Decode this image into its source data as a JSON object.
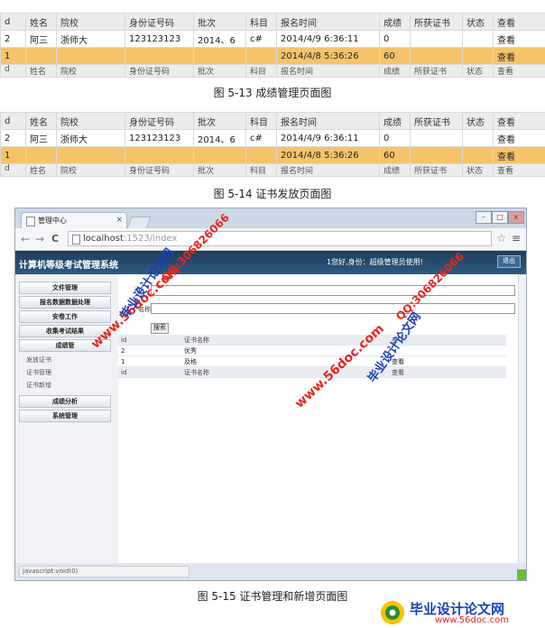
{
  "table_5_13": {
    "header": [
      "d",
      "姓名",
      "院校",
      "身份证号码",
      "批次",
      "科目",
      "报名时间",
      "成绩",
      "所获证书",
      "状态",
      "查看"
    ],
    "rows": [
      [
        "2",
        "阿三",
        "浙师大",
        "123123123",
        "2014、6",
        "c#",
        "2014/4/9 6:36:11",
        "0",
        "",
        "",
        "查看"
      ],
      [
        "1",
        "",
        "",
        "",
        "",
        "",
        "2014/4/8 5:36:26",
        "60",
        "",
        "",
        "查看"
      ]
    ],
    "footer": [
      "d",
      "姓名",
      "院校",
      "身份证号码",
      "批次",
      "科目",
      "报名时间",
      "成绩",
      "所获证书",
      "状态",
      "查看"
    ]
  },
  "caption_5_13": "图 5-13 成绩管理页面图",
  "table_5_14": {
    "header": [
      "d",
      "姓名",
      "院校",
      "身份证号码",
      "批次",
      "科目",
      "报名时间",
      "成绩",
      "所获证书",
      "状态",
      "查看"
    ],
    "rows": [
      [
        "2",
        "阿三",
        "浙师大",
        "123123123",
        "2014、6",
        "c#",
        "2014/4/9 6:36:11",
        "0",
        "",
        "",
        "查看"
      ],
      [
        "1",
        "",
        "",
        "",
        "",
        "",
        "2014/4/8 5:36:26",
        "60",
        "",
        "",
        "查看"
      ]
    ],
    "footer": [
      "d",
      "姓名",
      "院校",
      "身份证号码",
      "批次",
      "科目",
      "报名时间",
      "成绩",
      "所获证书",
      "状态",
      "查看"
    ]
  },
  "caption_5_14": "图 5-14 证书发放页面图",
  "browser": {
    "tab_title": "管理中心",
    "tab_close": "×",
    "url_host": "localhost",
    "url_rest": ":1523/index",
    "back": "←",
    "forward": "→",
    "reload": "C",
    "star": "☆",
    "menu": "≡",
    "win_min": "–",
    "win_max": "□",
    "win_close": "×"
  },
  "app": {
    "title": "计算机等级考试管理系统",
    "greeting": "1您好,身份：超级管理员使用!",
    "logout": "退出",
    "sidebar": {
      "items": [
        "文件管理",
        "报名数据数据处理",
        "安卷工作",
        "收集考试结果",
        "成绩管"
      ],
      "subitems": [
        "发放证书",
        "证书管理",
        "证书新增"
      ],
      "bottom_items": [
        "成绩分析",
        "系统管理"
      ]
    },
    "form": {
      "label_1": "id",
      "label_2": "名称",
      "search_button": "搜索"
    },
    "cert_table": {
      "header": [
        "id",
        "证书名称",
        "查"
      ],
      "rows": [
        [
          "2",
          "优秀",
          ""
        ],
        [
          "1",
          "及格",
          "查看"
        ]
      ],
      "footer": [
        "id",
        "证书名称",
        "查看"
      ]
    },
    "status_text": "javascript:void(0)"
  },
  "caption_5_15": "图 5-15 证书管理和新增页面图",
  "watermarks": {
    "site": "www.56doc.com",
    "qq": "QQ:306826066",
    "brand": "毕业设计论文网"
  },
  "bottom_logo": {
    "name": "毕业设计论文网",
    "url": "www.56doc.com"
  },
  "colors": {
    "highlight_row": "#f5c46a",
    "header_bg": "#2e5a82",
    "watermark_red": "#e8261e",
    "watermark_blue": "#1a3fb8"
  }
}
